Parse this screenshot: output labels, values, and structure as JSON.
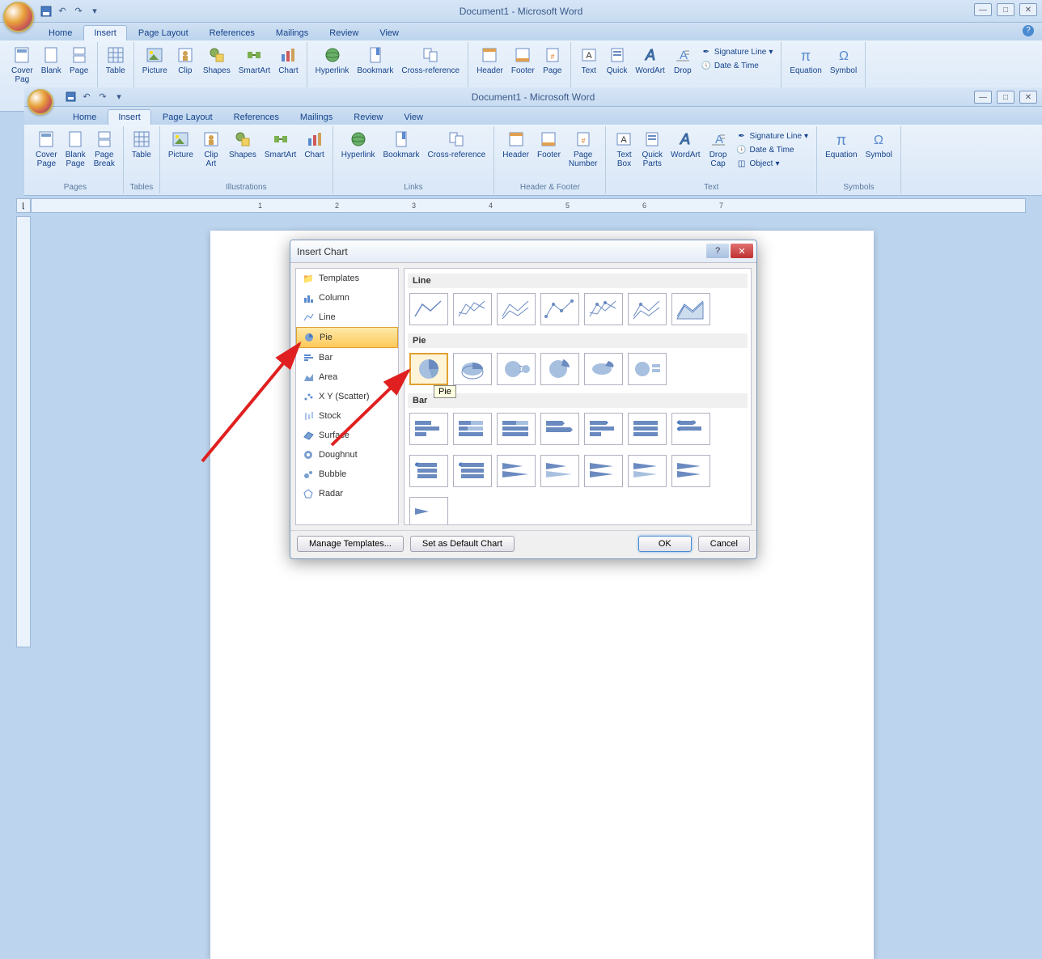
{
  "window": {
    "title": "Document1 - Microsoft Word"
  },
  "tabs": {
    "home": "Home",
    "insert": "Insert",
    "page_layout": "Page Layout",
    "references": "References",
    "mailings": "Mailings",
    "review": "Review",
    "view": "View"
  },
  "ribbon1": {
    "cover_page": "Cover\nPag",
    "blank": "Blank",
    "page": "Page",
    "table": "Table",
    "picture": "Picture",
    "clip": "Clip",
    "shapes": "Shapes",
    "smartart": "SmartArt",
    "chart": "Chart",
    "hyperlink": "Hyperlink",
    "bookmark": "Bookmark",
    "cross_ref": "Cross-reference",
    "header": "Header",
    "footer": "Footer",
    "page_btn": "Page",
    "text": "Text",
    "quick": "Quick",
    "wordart": "WordArt",
    "drop": "Drop",
    "signature": "Signature Line",
    "datetime": "Date & Time",
    "equation": "Equation",
    "symbol": "Symbol"
  },
  "ribbon2": {
    "cover_page": "Cover\nPage",
    "blank_page": "Blank\nPage",
    "page_break": "Page\nBreak",
    "table": "Table",
    "picture": "Picture",
    "clip_art": "Clip\nArt",
    "shapes": "Shapes",
    "smartart": "SmartArt",
    "chart": "Chart",
    "hyperlink": "Hyperlink",
    "bookmark": "Bookmark",
    "cross_ref": "Cross-reference",
    "header": "Header",
    "footer": "Footer",
    "page_number": "Page\nNumber",
    "text_box": "Text\nBox",
    "quick_parts": "Quick\nParts",
    "wordart": "WordArt",
    "drop_cap": "Drop\nCap",
    "signature": "Signature Line",
    "datetime": "Date & Time",
    "object": "Object",
    "equation": "Equation",
    "symbol": "Symbol",
    "g_pages": "Pages",
    "g_tables": "Tables",
    "g_illustrations": "Illustrations",
    "g_links": "Links",
    "g_hf": "Header & Footer",
    "g_text": "Text",
    "g_symbols": "Symbols"
  },
  "ruler": {
    "n1": "1",
    "n2": "2",
    "n3": "3",
    "n4": "4",
    "n5": "5",
    "n6": "6",
    "n7": "7"
  },
  "dialog": {
    "title": "Insert Chart",
    "categories": {
      "templates": "Templates",
      "column": "Column",
      "line": "Line",
      "pie": "Pie",
      "bar": "Bar",
      "area": "Area",
      "xy": "X Y (Scatter)",
      "stock": "Stock",
      "surface": "Surface",
      "doughnut": "Doughnut",
      "bubble": "Bubble",
      "radar": "Radar"
    },
    "sections": {
      "line": "Line",
      "pie": "Pie",
      "bar": "Bar"
    },
    "tooltip": "Pie",
    "manage_templates": "Manage Templates...",
    "set_default": "Set as Default Chart",
    "ok": "OK",
    "cancel": "Cancel"
  }
}
